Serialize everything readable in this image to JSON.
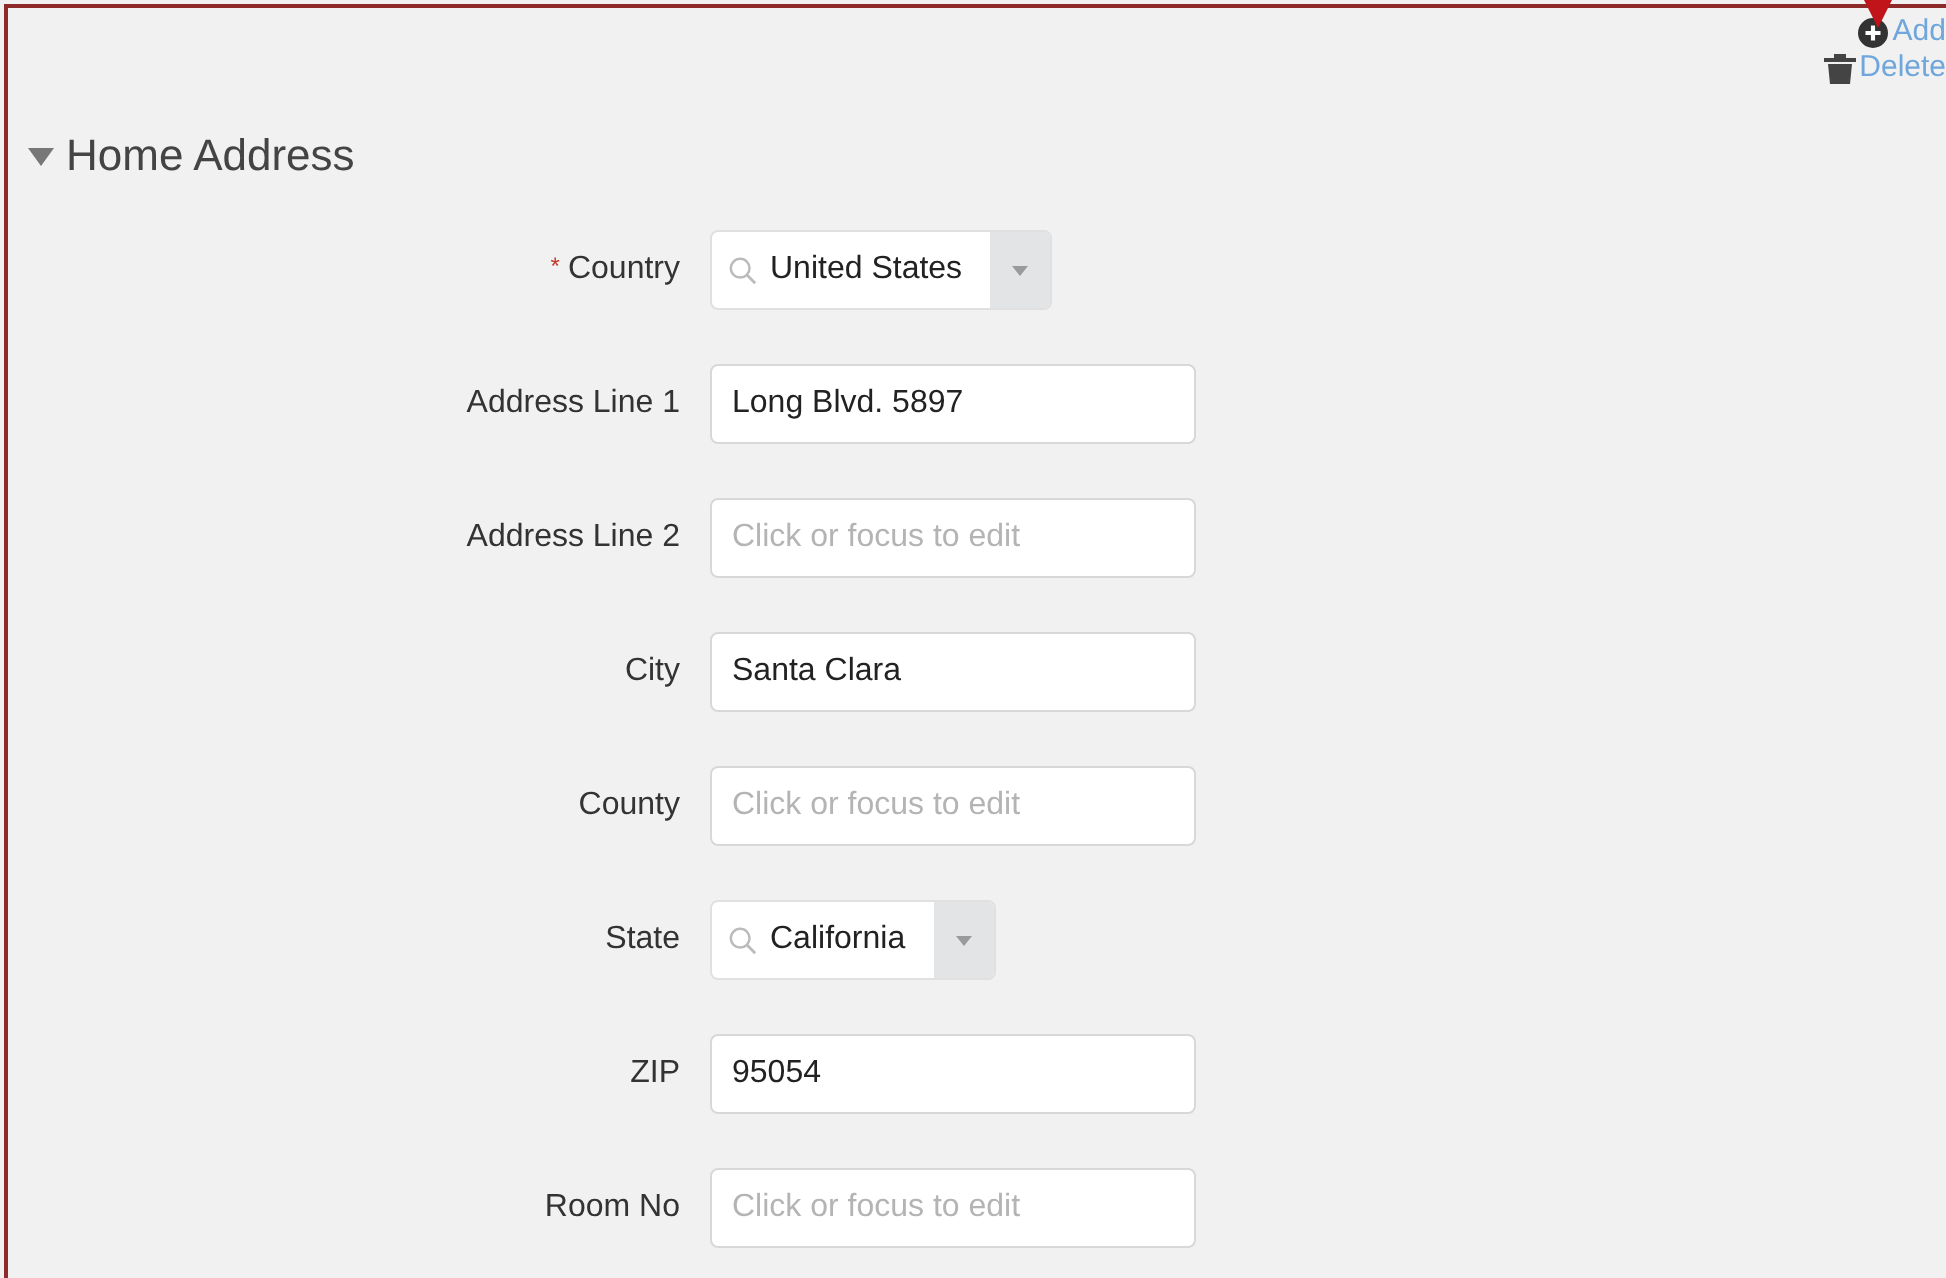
{
  "actions": [
    {
      "kind": "add",
      "label": "Add"
    },
    {
      "kind": "delete",
      "label": "Delete"
    }
  ],
  "section": {
    "title": "Home Address",
    "expanded": true,
    "fields": [
      {
        "kind": "combo",
        "label": "Country",
        "required_mark": "*",
        "value": "United States"
      },
      {
        "kind": "text",
        "label": "Address Line 1",
        "value": "Long Blvd. 5897"
      },
      {
        "kind": "text",
        "label": "Address Line 2",
        "placeholder": "Click or focus to edit"
      },
      {
        "kind": "text",
        "label": "City",
        "value": "Santa Clara"
      },
      {
        "kind": "text",
        "label": "County",
        "placeholder": "Click or focus to edit"
      },
      {
        "kind": "combo",
        "label": "State",
        "value": "California"
      },
      {
        "kind": "text",
        "label": "ZIP",
        "value": "95054"
      },
      {
        "kind": "text",
        "label": "Room No",
        "placeholder": "Click or focus to edit"
      }
    ]
  }
}
